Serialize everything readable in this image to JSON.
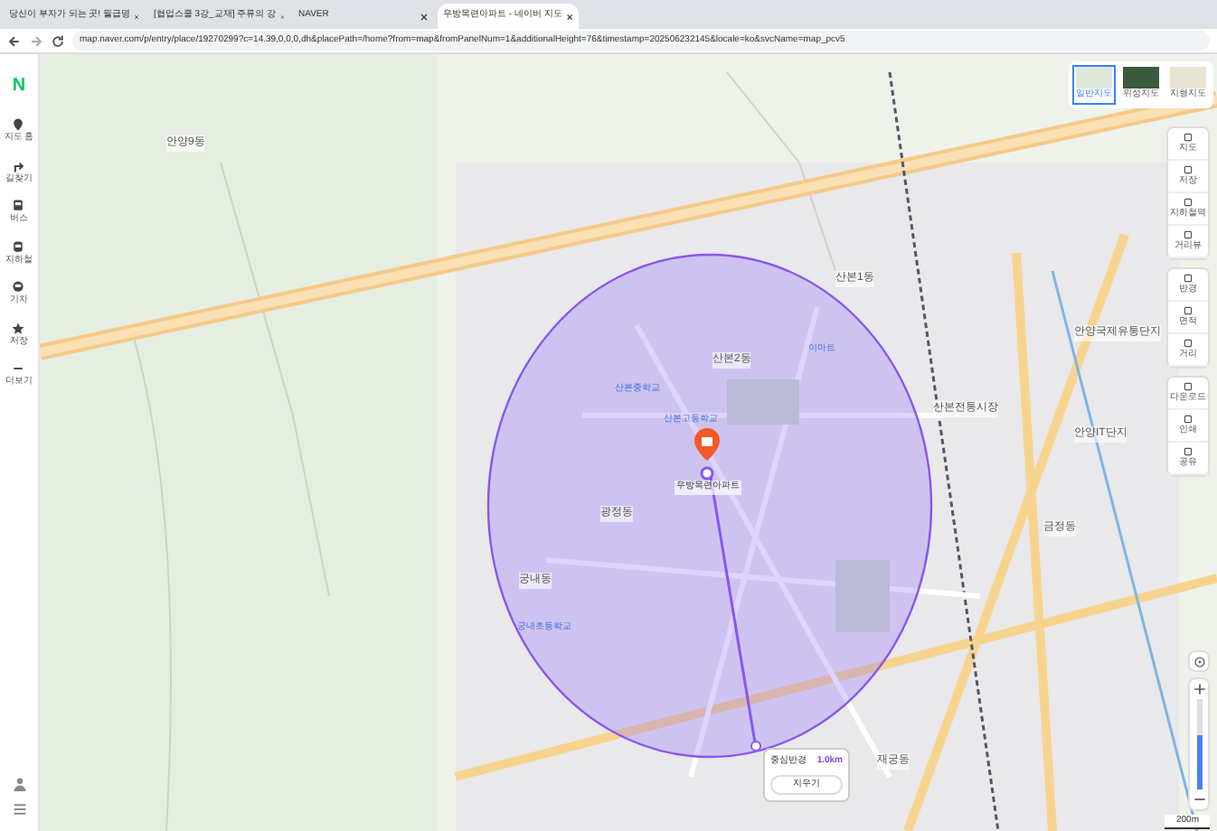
{
  "browser": {
    "tabs": [
      {
        "title": "당신이 부자가 되는 곳! 월급명",
        "selected": false
      },
      {
        "title": "[협업스쿨 3강_교재] 주류의 강",
        "selected": false
      },
      {
        "title": "NAVER",
        "selected": false
      },
      {
        "title": "우방목련아파트 - 네이버 지도",
        "selected": true
      }
    ],
    "url": "map.naver.com/p/entry/place/19270299?c=14.39,0,0,0,dh&placePath=/home?from=map&fromPanelNum=1&additionalHeight=76&timestamp=202506232145&locale=ko&svcName=map_pcv5"
  },
  "sidebar": {
    "logo": "N",
    "items": [
      {
        "label": "지도 홈"
      },
      {
        "label": "길찾기"
      },
      {
        "label": "버스"
      },
      {
        "label": "지하철"
      },
      {
        "label": "기차"
      },
      {
        "label": "저장"
      },
      {
        "label": "더보기"
      }
    ]
  },
  "map_types": [
    {
      "label": "일반지도",
      "selected": true
    },
    {
      "label": "위성지도",
      "selected": false
    },
    {
      "label": "지형지도",
      "selected": false
    }
  ],
  "tools": [
    {
      "label": "지도"
    },
    {
      "label": "저장"
    },
    {
      "label": "지하철역"
    },
    {
      "label": "거리뷰"
    },
    {
      "label": "반경"
    },
    {
      "label": "면적"
    },
    {
      "label": "거리"
    },
    {
      "label": "다운로드"
    },
    {
      "label": "인쇄"
    },
    {
      "label": "공유"
    }
  ],
  "zoom": {
    "level": 0.6
  },
  "map": {
    "place": "우방목련아파트",
    "labels": [
      {
        "text": "안양9동",
        "kind": "area"
      },
      {
        "text": "산본1동",
        "kind": "area"
      },
      {
        "text": "안양국제유통단지",
        "kind": "area"
      },
      {
        "text": "이마트",
        "kind": "school"
      },
      {
        "text": "산본2동",
        "kind": "area"
      },
      {
        "text": "산본중학교",
        "kind": "school"
      },
      {
        "text": "산본전통시장",
        "kind": "area"
      },
      {
        "text": "산본고등학교",
        "kind": "school"
      },
      {
        "text": "안양IT단지",
        "kind": "area"
      },
      {
        "text": "광정동",
        "kind": "area"
      },
      {
        "text": "금정동",
        "kind": "area"
      },
      {
        "text": "궁내동",
        "kind": "area"
      },
      {
        "text": "궁내초등학교",
        "kind": "school"
      },
      {
        "text": "재궁동",
        "kind": "area"
      }
    ]
  },
  "radius_panel": {
    "label": "중심반경",
    "value": "1.0km",
    "button": "지우기"
  },
  "scale": "200m"
}
